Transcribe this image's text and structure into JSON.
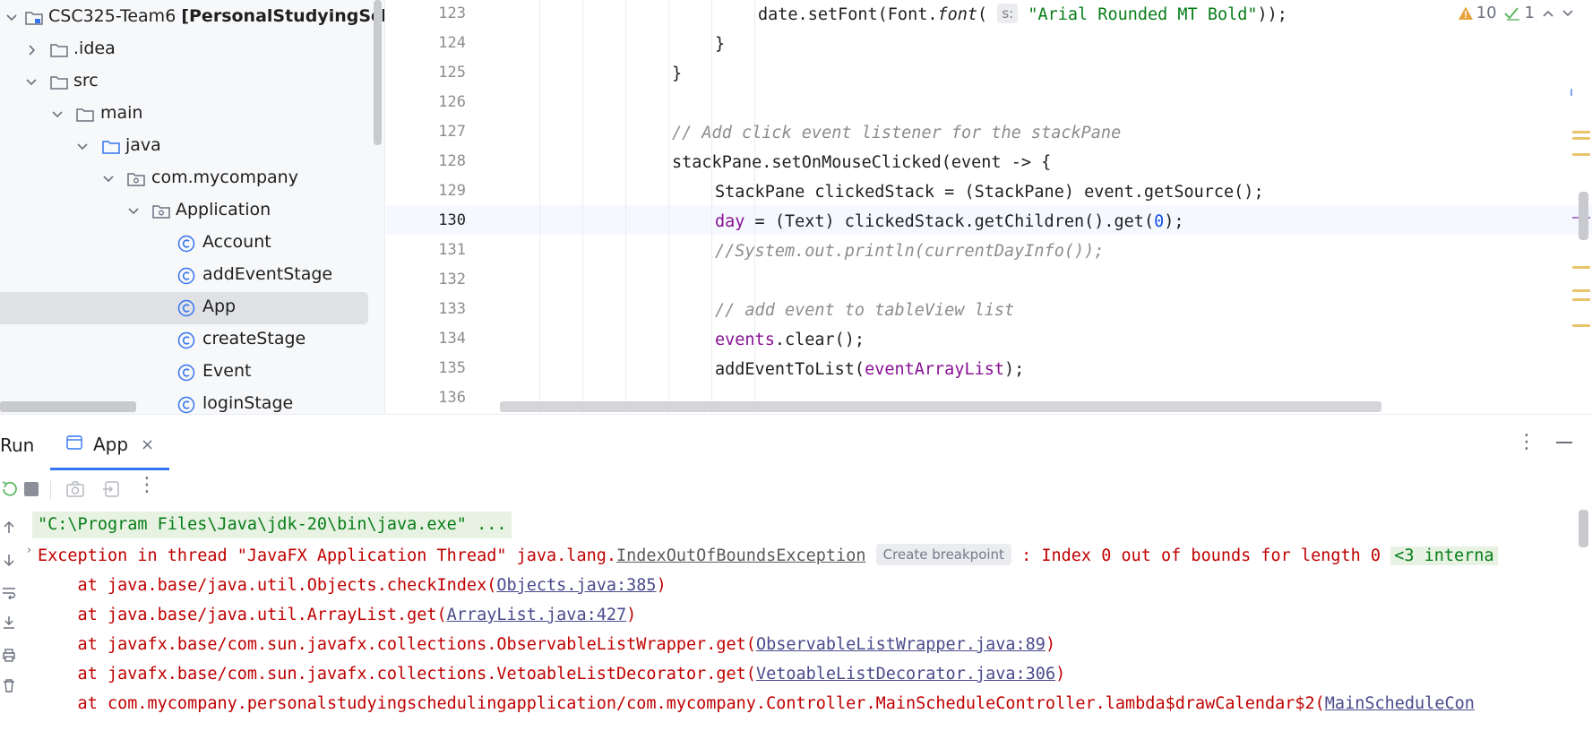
{
  "project_tree": {
    "items": [
      {
        "label": "CSC325-Team6",
        "suffix": "[PersonalStudyingSch",
        "kind": "module",
        "expanded": true
      },
      {
        "label": ".idea",
        "kind": "folder",
        "expanded": false
      },
      {
        "label": "src",
        "kind": "folder",
        "expanded": true
      },
      {
        "label": "main",
        "kind": "folder",
        "expanded": true
      },
      {
        "label": "java",
        "kind": "source-folder",
        "expanded": true
      },
      {
        "label": "com.mycompany",
        "kind": "package",
        "expanded": true
      },
      {
        "label": "Application",
        "kind": "package",
        "expanded": true
      },
      {
        "label": "Account",
        "kind": "class"
      },
      {
        "label": "addEventStage",
        "kind": "class"
      },
      {
        "label": "App",
        "kind": "class",
        "selected": true
      },
      {
        "label": "createStage",
        "kind": "class"
      },
      {
        "label": "Event",
        "kind": "class"
      },
      {
        "label": "loginStage",
        "kind": "class"
      }
    ]
  },
  "editor": {
    "line_numbers": [
      "123",
      "124",
      "125",
      "126",
      "127",
      "128",
      "129",
      "130",
      "131",
      "132",
      "133",
      "134",
      "135",
      "136"
    ],
    "current_line": "130",
    "inspections": {
      "warnings": "10",
      "weak_warnings": "1"
    },
    "code": {
      "l123_a": "date.setFont(Font.",
      "l123_b": "font",
      "l123_c": "( ",
      "l123_hint": "s:",
      "l123_str": "\"Arial Rounded MT Bold\"",
      "l123_d": "));",
      "l124": "}",
      "l125": "}",
      "l127": "// Add click event listener for the stackPane",
      "l128": "stackPane.setOnMouseClicked(event -> {",
      "l129": "StackPane clickedStack = (StackPane) event.getSource();",
      "l130_field": "day",
      "l130_a": " = (Text) clickedStack.getChildren().get(",
      "l130_num": "0",
      "l130_b": ");",
      "l131": "//System.out.println(currentDayInfo());",
      "l133": "// add event to tableView list",
      "l134_field": "events",
      "l134_a": ".clear();",
      "l135_a": "addEventToList(",
      "l135_field": "eventArrayList",
      "l135_b": ");"
    }
  },
  "run_panel": {
    "title": "Run",
    "tab_label": "App",
    "tab_close": "×",
    "console": {
      "command": "\"C:\\Program Files\\Java\\jdk-20\\bin\\java.exe\" ...",
      "exception_prefix": "Exception in thread \"JavaFX Application Thread\" java.lang.",
      "exception_link": "IndexOutOfBoundsException",
      "breakpoint_label": "Create breakpoint",
      "exception_suffix": " : Index 0 out of bounds for length 0 ",
      "internal_calls": "<3 interna",
      "frames": [
        {
          "text": "    at java.base/java.util.Objects.checkIndex(",
          "link": "Objects.java:385",
          "end": ")"
        },
        {
          "text": "    at java.base/java.util.ArrayList.get(",
          "link": "ArrayList.java:427",
          "end": ")"
        },
        {
          "text": "    at javafx.base/com.sun.javafx.collections.ObservableListWrapper.get(",
          "link": "ObservableListWrapper.java:89",
          "end": ")"
        },
        {
          "text": "    at javafx.base/com.sun.javafx.collections.VetoableListDecorator.get(",
          "link": "VetoableListDecorator.java:306",
          "end": ")"
        },
        {
          "text": "    at com.mycompany.personalstudyingschedulingapplication/com.mycompany.Controller.MainScheduleController.lambda$drawCalendar$2(",
          "link": "MainScheduleCon",
          "end": ""
        }
      ]
    }
  },
  "colors": {
    "accent": "#3574f0",
    "error_text": "#c00000",
    "string": "#067d17",
    "keyword_field": "#871094",
    "selection": "#dfe1e5"
  }
}
